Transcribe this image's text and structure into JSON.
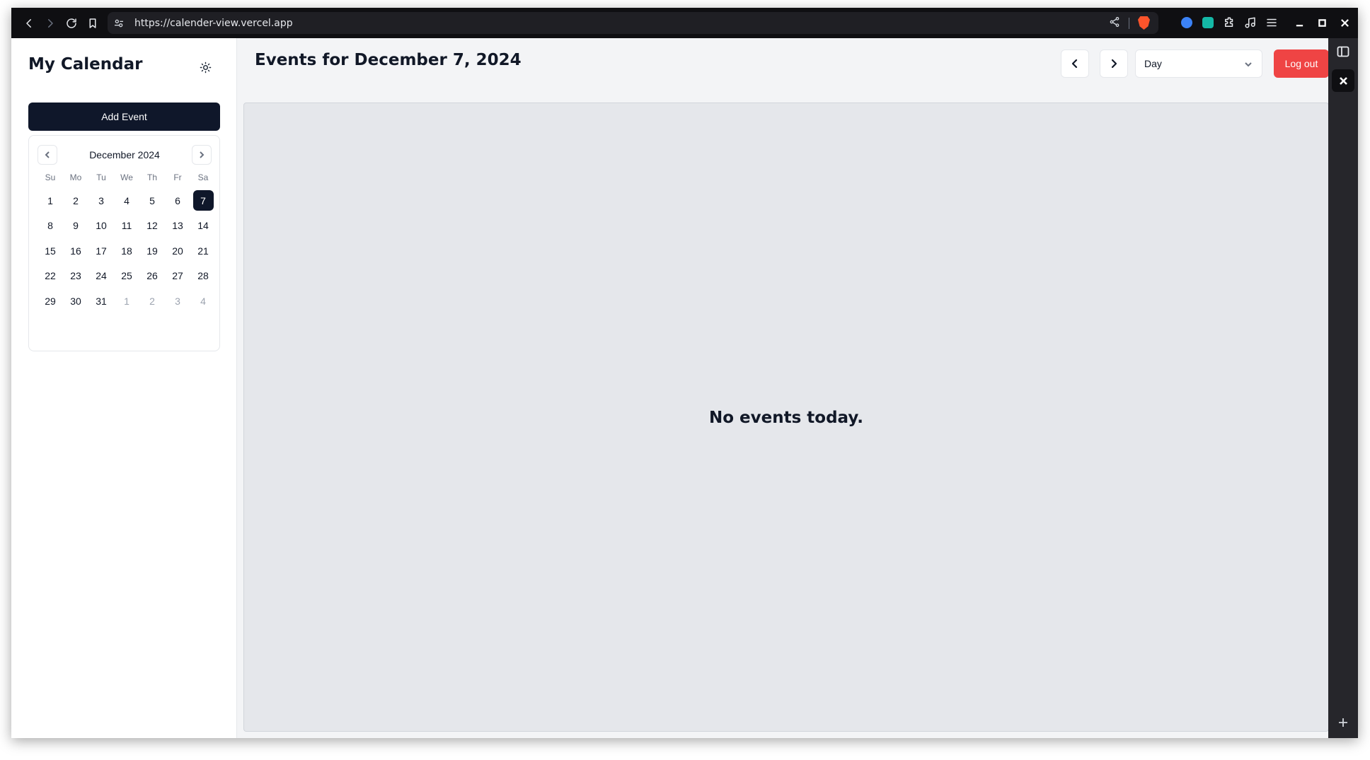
{
  "browser": {
    "url": "https://calender-view.vercel.app"
  },
  "sidebar": {
    "title": "My Calendar",
    "add_event_label": "Add Event",
    "calendar": {
      "month_label": "December 2024",
      "weekdays": [
        "Su",
        "Mo",
        "Tu",
        "We",
        "Th",
        "Fr",
        "Sa"
      ],
      "weeks": [
        [
          "1",
          "2",
          "3",
          "4",
          "5",
          "6",
          "7"
        ],
        [
          "8",
          "9",
          "10",
          "11",
          "12",
          "13",
          "14"
        ],
        [
          "15",
          "16",
          "17",
          "18",
          "19",
          "20",
          "21"
        ],
        [
          "22",
          "23",
          "24",
          "25",
          "26",
          "27",
          "28"
        ],
        [
          "29",
          "30",
          "31",
          "1",
          "2",
          "3",
          "4"
        ]
      ],
      "selected_day": "7"
    }
  },
  "main": {
    "title": "Events for December 7, 2024",
    "view_select_value": "Day",
    "logout_label": "Log out",
    "empty_message": "No events today."
  },
  "colors": {
    "primary_dark": "#0f172a",
    "logout_red": "#ef4444",
    "panel_bg": "#e5e7eb"
  }
}
